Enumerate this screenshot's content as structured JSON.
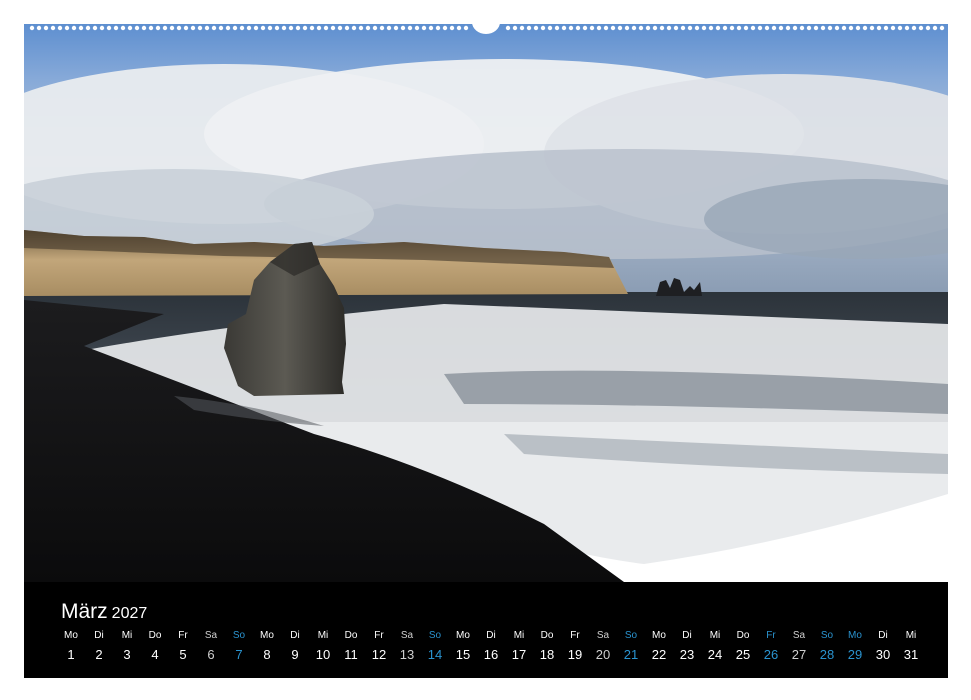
{
  "calendar": {
    "month": "März",
    "year": "2027",
    "days": [
      {
        "weekday": "Mo",
        "day": "1",
        "type": "weekday"
      },
      {
        "weekday": "Di",
        "day": "2",
        "type": "weekday"
      },
      {
        "weekday": "Mi",
        "day": "3",
        "type": "weekday"
      },
      {
        "weekday": "Do",
        "day": "4",
        "type": "weekday"
      },
      {
        "weekday": "Fr",
        "day": "5",
        "type": "weekday"
      },
      {
        "weekday": "Sa",
        "day": "6",
        "type": "saturday"
      },
      {
        "weekday": "So",
        "day": "7",
        "type": "sunday"
      },
      {
        "weekday": "Mo",
        "day": "8",
        "type": "weekday"
      },
      {
        "weekday": "Di",
        "day": "9",
        "type": "weekday"
      },
      {
        "weekday": "Mi",
        "day": "10",
        "type": "weekday"
      },
      {
        "weekday": "Do",
        "day": "11",
        "type": "weekday"
      },
      {
        "weekday": "Fr",
        "day": "12",
        "type": "weekday"
      },
      {
        "weekday": "Sa",
        "day": "13",
        "type": "saturday"
      },
      {
        "weekday": "So",
        "day": "14",
        "type": "sunday"
      },
      {
        "weekday": "Mo",
        "day": "15",
        "type": "weekday"
      },
      {
        "weekday": "Di",
        "day": "16",
        "type": "weekday"
      },
      {
        "weekday": "Mi",
        "day": "17",
        "type": "weekday"
      },
      {
        "weekday": "Do",
        "day": "18",
        "type": "weekday"
      },
      {
        "weekday": "Fr",
        "day": "19",
        "type": "weekday"
      },
      {
        "weekday": "Sa",
        "day": "20",
        "type": "saturday"
      },
      {
        "weekday": "So",
        "day": "21",
        "type": "sunday"
      },
      {
        "weekday": "Mo",
        "day": "22",
        "type": "weekday"
      },
      {
        "weekday": "Di",
        "day": "23",
        "type": "weekday"
      },
      {
        "weekday": "Mi",
        "day": "24",
        "type": "weekday"
      },
      {
        "weekday": "Do",
        "day": "25",
        "type": "weekday"
      },
      {
        "weekday": "Fr",
        "day": "26",
        "type": "holiday"
      },
      {
        "weekday": "Sa",
        "day": "27",
        "type": "saturday"
      },
      {
        "weekday": "So",
        "day": "28",
        "type": "sunday"
      },
      {
        "weekday": "Mo",
        "day": "29",
        "type": "holiday"
      },
      {
        "weekday": "Di",
        "day": "30",
        "type": "weekday"
      },
      {
        "weekday": "Mi",
        "day": "31",
        "type": "weekday"
      }
    ]
  },
  "colors": {
    "weekday": "#ffffff",
    "saturday": "#cfcfcf",
    "sunday": "#2a93cf",
    "holiday": "#2a93cf",
    "footer_background": "#000000"
  },
  "photo": {
    "subject": "black sand beach with basalt sea stack, surf and cliff headland"
  }
}
